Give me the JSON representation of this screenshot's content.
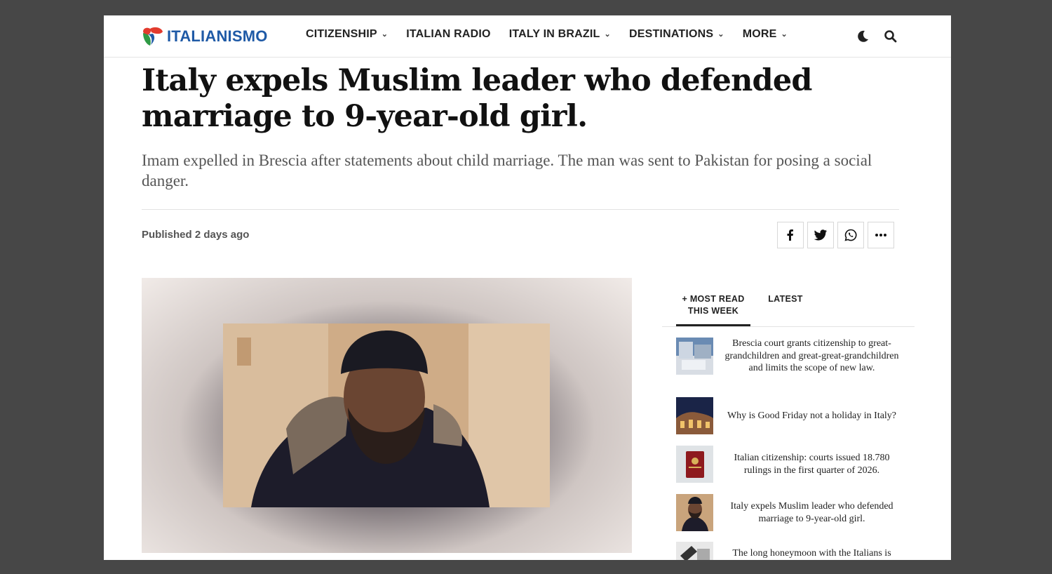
{
  "header": {
    "logo_text": "ITALIANISMO",
    "nav": [
      {
        "label": "CITIZENSHIP",
        "dropdown": true
      },
      {
        "label": "ITALIAN RADIO",
        "dropdown": false
      },
      {
        "label": "ITALY IN BRAZIL",
        "dropdown": true
      },
      {
        "label": "DESTINATIONS",
        "dropdown": true
      },
      {
        "label": "MORE",
        "dropdown": true
      }
    ],
    "icons": [
      "dark-mode-moon-icon",
      "search-icon"
    ]
  },
  "article": {
    "title": "Italy expels Muslim leader who defended marriage to 9-year-old girl.",
    "subtitle": "Imam expelled in Brescia after statements about child marriage. The man was sent to Pakistan for posing a social danger.",
    "published_label": "Published",
    "published_value": "2 days ago",
    "share_icons": [
      "facebook-icon",
      "twitter-icon",
      "whatsapp-icon",
      "more-dots-icon"
    ]
  },
  "sidebar": {
    "tabs": [
      {
        "label": "+ MOST READ THIS WEEK",
        "active": true
      },
      {
        "label": "LATEST",
        "active": false
      }
    ],
    "items": [
      {
        "text": "Brescia court grants citizenship to great-grandchildren and great-great-grandchildren and limits the scope of new law."
      },
      {
        "text": "Why is Good Friday not a holiday in Italy?"
      },
      {
        "text": "Italian citizenship: courts issued 18.780 rulings in the first quarter of 2026."
      },
      {
        "text": "Italy expels Muslim leader who defended marriage to 9-year-old girl."
      },
      {
        "text": "The long honeymoon with the Italians is"
      }
    ]
  },
  "colors": {
    "background": "#474747",
    "page": "#ffffff",
    "logo_blue": "#1f5aa6",
    "text_dark": "#111111",
    "text_muted": "#555555"
  }
}
